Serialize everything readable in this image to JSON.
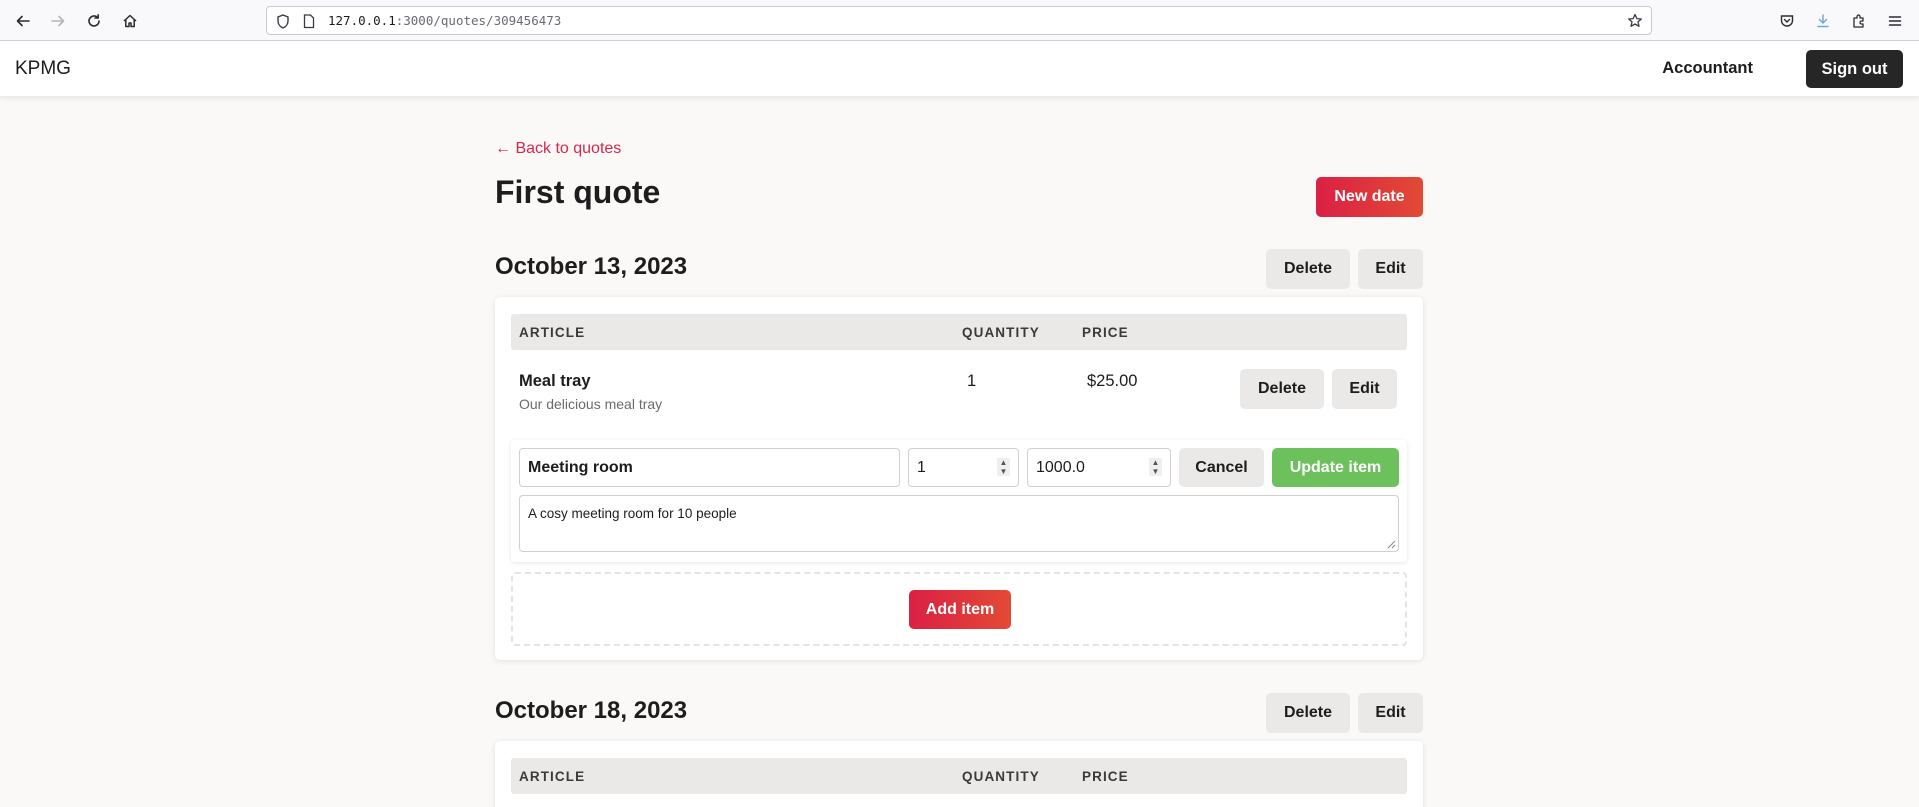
{
  "browser": {
    "url_host": "127.0.0.1",
    "url_path": ":3000/quotes/309456473"
  },
  "navbar": {
    "brand": "KPMG",
    "user_name": "Accountant",
    "sign_out_label": "Sign out"
  },
  "page": {
    "back_link": "← Back to quotes",
    "title": "First quote",
    "new_date_label": "New date"
  },
  "table_headers": {
    "article": "ARTICLE",
    "quantity": "QUANTITY",
    "price": "PRICE"
  },
  "dates": [
    {
      "title": "October 13, 2023",
      "delete_label": "Delete",
      "edit_label": "Edit",
      "items": [
        {
          "name": "Meal tray",
          "description": "Our delicious meal tray",
          "quantity": "1",
          "price": "$25.00",
          "delete_label": "Delete",
          "edit_label": "Edit"
        }
      ],
      "edit_form": {
        "name_value": "Meeting room",
        "quantity_value": "1",
        "price_value": "1000.0",
        "description_value": "A cosy meeting room for 10 people",
        "cancel_label": "Cancel",
        "submit_label": "Update item"
      },
      "add_item_label": "Add item"
    },
    {
      "title": "October 18, 2023",
      "delete_label": "Delete",
      "edit_label": "Edit"
    }
  ],
  "colors": {
    "primary": "#db2045",
    "success": "#6cc15c",
    "dark_button": "#262626",
    "link": "#d3294b"
  }
}
